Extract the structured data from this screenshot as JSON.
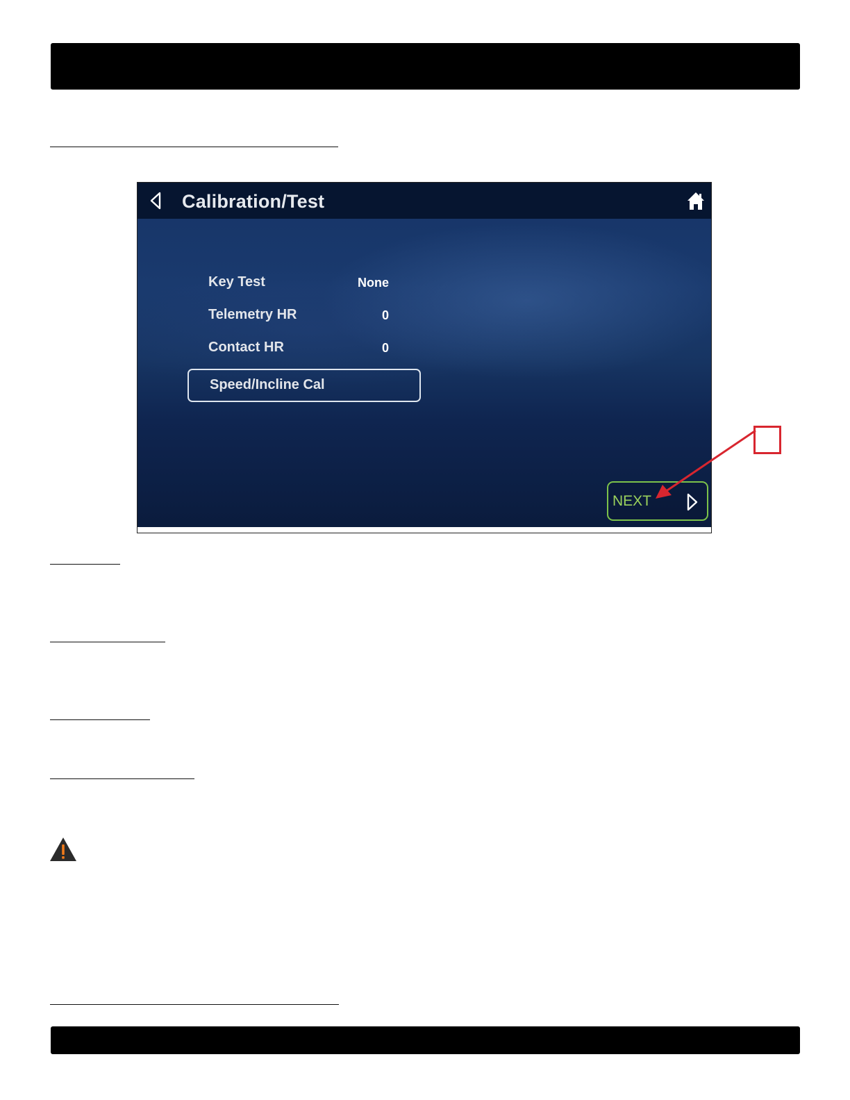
{
  "screen": {
    "title": "Calibration/Test",
    "menu": [
      {
        "label": "Key Test",
        "value": "None"
      },
      {
        "label": "Telemetry HR",
        "value": "0"
      },
      {
        "label": "Contact HR",
        "value": "0"
      }
    ],
    "selected_item": "Speed/Incline Cal",
    "next_label": "NEXT"
  },
  "icons": {
    "back": "chevron-left-icon",
    "home": "home-icon",
    "next": "chevron-right-icon",
    "warning": "warning-icon"
  },
  "colors": {
    "screen_bg": "#173563",
    "titlebar_bg": "#061530",
    "next_accent": "#7cc24a",
    "callout": "#d8262f",
    "warning_fill": "#2b2b2b",
    "warning_mark": "#f07a1a"
  }
}
